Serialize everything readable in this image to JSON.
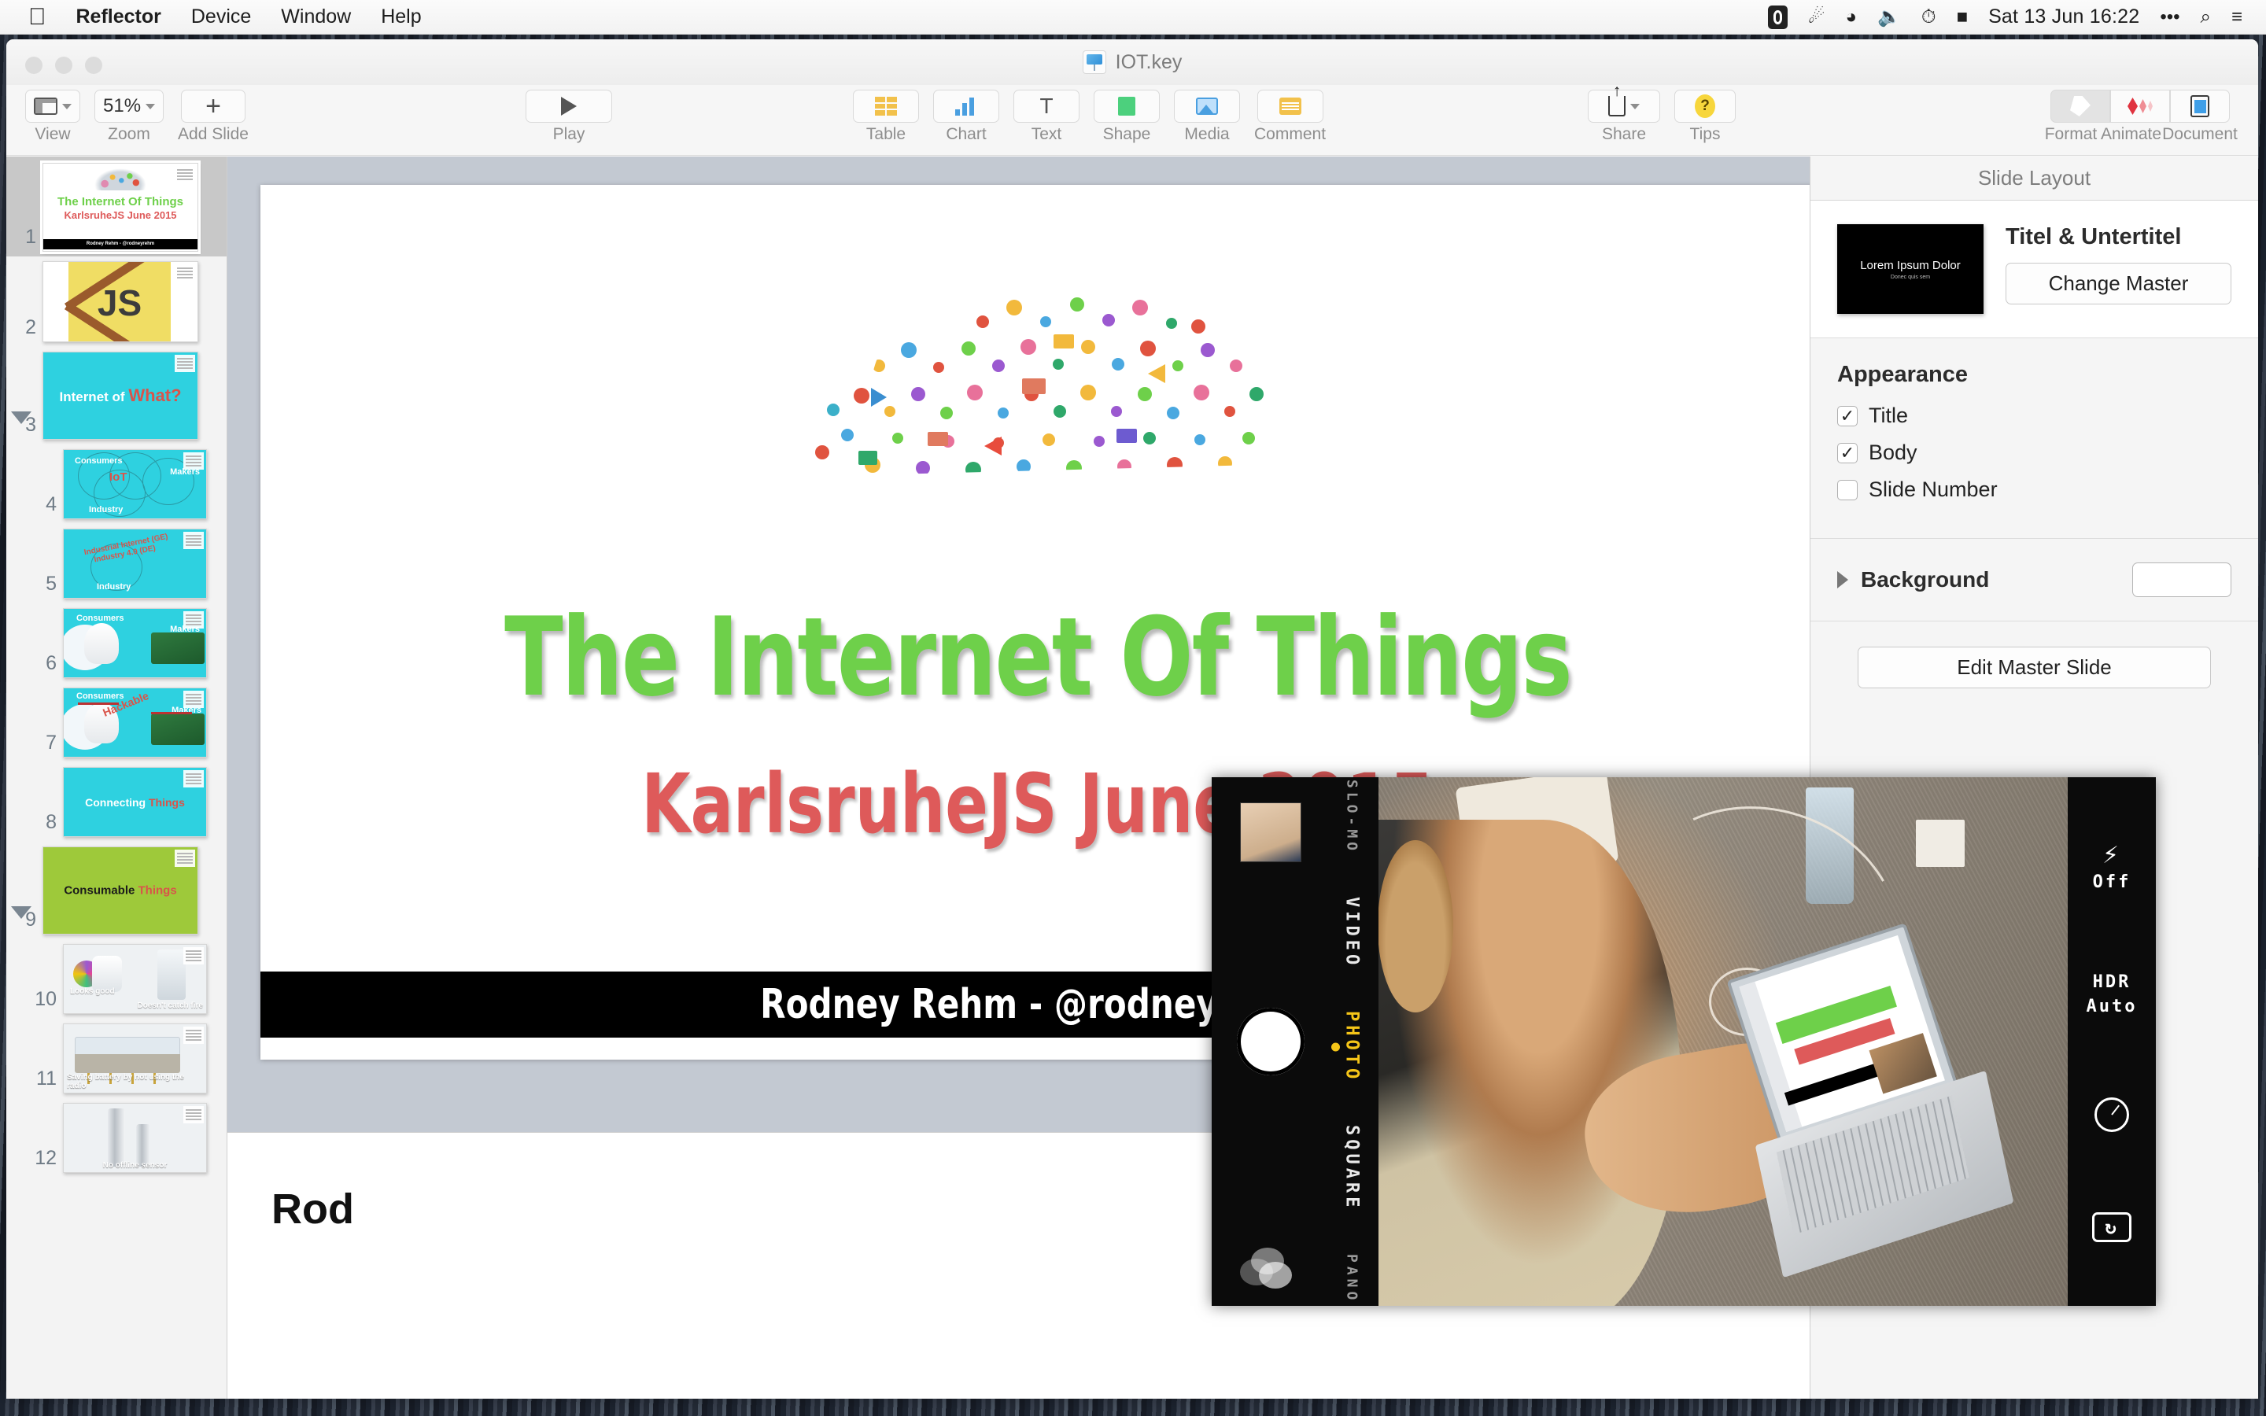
{
  "menubar": {
    "apple": "",
    "items": [
      "Reflector",
      "Device",
      "Window",
      "Help"
    ],
    "status_icons": [
      "reflector-icon",
      "bluetooth-icon",
      "wifi-icon",
      "volume-icon",
      "timemachine-icon",
      "battery-icon"
    ],
    "bluetooth": "✶",
    "wifi": "◔",
    "volume": "🔊",
    "clock": "Sat 13 Jun  16:22",
    "more": "•••",
    "search": "⌕",
    "notifications": "≡"
  },
  "window": {
    "title": "IOT.key"
  },
  "toolbar": {
    "view": {
      "label": "View",
      "icon": "view-icon"
    },
    "zoom": {
      "label": "Zoom",
      "value": "51%"
    },
    "add_slide": {
      "label": "Add Slide",
      "icon": "plus-icon"
    },
    "play": {
      "label": "Play",
      "icon": "play-icon"
    },
    "insert": [
      {
        "label": "Table",
        "icon": "table-icon"
      },
      {
        "label": "Chart",
        "icon": "chart-icon"
      },
      {
        "label": "Text",
        "icon": "text-icon",
        "glyph": "T"
      },
      {
        "label": "Shape",
        "icon": "shape-icon"
      },
      {
        "label": "Media",
        "icon": "media-icon"
      },
      {
        "label": "Comment",
        "icon": "comment-icon"
      }
    ],
    "share": {
      "label": "Share",
      "icon": "share-icon"
    },
    "tips": {
      "label": "Tips",
      "icon": "tips-icon",
      "glyph": "?"
    },
    "inspectors": [
      {
        "label": "Format",
        "icon": "format-brush-icon",
        "selected": true
      },
      {
        "label": "Animate",
        "icon": "animate-diamond-icon",
        "selected": false
      },
      {
        "label": "Document",
        "icon": "document-icon",
        "selected": false
      }
    ]
  },
  "navigator": {
    "slides": [
      {
        "number": "1",
        "selected": true,
        "title_green": "The Internet Of Things",
        "title_red": "KarlsruheJS June 2015",
        "footer": "Rodney Rehm - @rodneyrehm",
        "bg": "#ffffff",
        "kind": "title"
      },
      {
        "number": "2",
        "selected": false,
        "label": "JS",
        "bg": "#ffffff",
        "kind": "js-crossed"
      },
      {
        "number": "3",
        "selected": false,
        "text_white": "Internet of ",
        "text_red": "What?",
        "bg": "#2ed1e0",
        "kind": "text",
        "group": true
      },
      {
        "number": "4",
        "selected": false,
        "bg": "#2ed1e0",
        "kind": "venn",
        "labels": [
          "Consumers",
          "Makers",
          "Industry"
        ],
        "center": "IoT"
      },
      {
        "number": "5",
        "selected": false,
        "bg": "#2ed1e0",
        "kind": "venn-industry",
        "labels": [
          "Industry"
        ],
        "red1": "Industrial Internet (GE)",
        "red2": "Industry 4.0 (DE)"
      },
      {
        "number": "6",
        "selected": false,
        "bg": "#2ed1e0",
        "kind": "devices",
        "labels": [
          "Consumers",
          "Makers"
        ]
      },
      {
        "number": "7",
        "selected": false,
        "bg": "#2ed1e0",
        "kind": "devices-hackable",
        "labels": [
          "Consumers",
          "Makers"
        ],
        "red": "Hackable"
      },
      {
        "number": "8",
        "selected": false,
        "bg": "#2ed1e0",
        "kind": "text",
        "text_white": "Connecting ",
        "text_red": "Things"
      },
      {
        "number": "9",
        "selected": false,
        "bg": "#9ec93a",
        "kind": "text",
        "text_white": "Consumable ",
        "text_red": "Things",
        "group": true
      },
      {
        "number": "10",
        "selected": false,
        "bg": "#eef1f3",
        "kind": "photo",
        "caption1": "Looks good",
        "caption2": "Doesn't catch fire"
      },
      {
        "number": "11",
        "selected": false,
        "bg": "#eef1f3",
        "kind": "photo",
        "caption1": "Saving battery by not using the radio"
      },
      {
        "number": "12",
        "selected": false,
        "bg": "#eef1f3",
        "kind": "photo",
        "caption1": "No offline sensor"
      }
    ]
  },
  "slide": {
    "graphic": "cloud-of-icons",
    "title": "The Internet Of Things",
    "subtitle": "KarlsruheJS June 2015",
    "footer": "Rodney Rehm - @rodneyrehm",
    "title_color": "#6ed04a",
    "subtitle_color": "#de5a5a"
  },
  "notes": {
    "text": "Rod"
  },
  "inspector": {
    "header": "Slide Layout",
    "master": {
      "name": "Titel & Untertitel",
      "thumb_line1": "Lorem Ipsum Dolor",
      "thumb_line2": "Donec quis sem",
      "change_button": "Change Master"
    },
    "appearance": {
      "title": "Appearance",
      "options": [
        {
          "label": "Title",
          "checked": true
        },
        {
          "label": "Body",
          "checked": true
        },
        {
          "label": "Slide Number",
          "checked": false
        }
      ]
    },
    "background": {
      "label": "Background",
      "expanded": false,
      "color": "#ffffff"
    },
    "edit_master": "Edit Master Slide"
  },
  "mirror": {
    "app": "iOS Camera",
    "modes": [
      "SLO-MO",
      "VIDEO",
      "PHOTO",
      "SQUARE",
      "PANO"
    ],
    "active_mode": "PHOTO",
    "active_color": "#f5c518",
    "flash": {
      "label": "Off",
      "icon": "flash-icon"
    },
    "hdr": {
      "line1": "HDR",
      "line2": "Auto"
    },
    "timer_icon": "timer-icon",
    "flip_icon": "camera-flip-icon",
    "shutter": "shutter-button",
    "thumbnail": "last-photo-thumbnail",
    "hdr_toggle": "hdr-overlap-circles"
  }
}
